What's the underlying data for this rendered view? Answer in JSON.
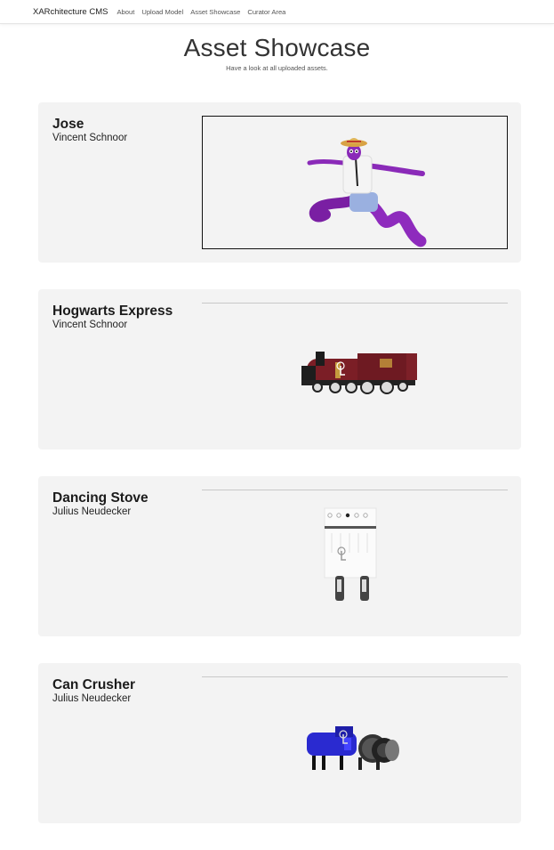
{
  "nav": {
    "brand": "XARchitecture CMS",
    "links": [
      "About",
      "Upload Model",
      "Asset Showcase",
      "Curator Area"
    ]
  },
  "header": {
    "title": "Asset Showcase",
    "subtitle": "Have a look at all uploaded assets."
  },
  "assets": [
    {
      "title": "Jose",
      "author": "Vincent Schnoor",
      "model": "purple-creature-model",
      "viewer_state": "active"
    },
    {
      "title": "Hogwarts Express",
      "author": "Vincent Schnoor",
      "model": "steam-locomotive-model",
      "viewer_state": "inactive"
    },
    {
      "title": "Dancing Stove",
      "author": "Julius Neudecker",
      "model": "stove-model",
      "viewer_state": "inactive"
    },
    {
      "title": "Can Crusher",
      "author": "Julius Neudecker",
      "model": "can-crusher-model",
      "viewer_state": "inactive"
    }
  ]
}
